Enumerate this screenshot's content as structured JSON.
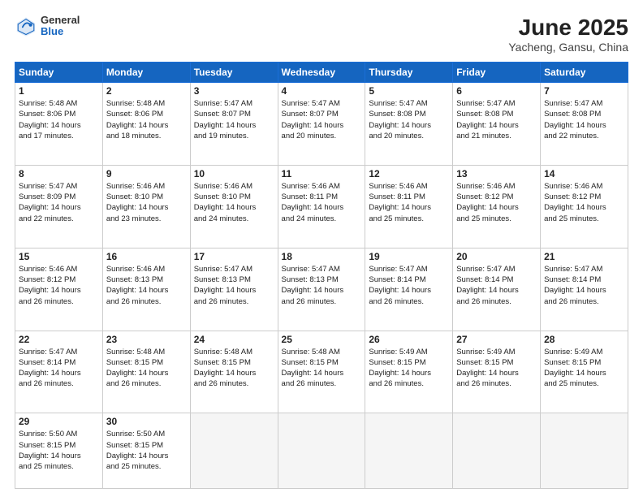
{
  "header": {
    "logo_general": "General",
    "logo_blue": "Blue",
    "month_title": "June 2025",
    "location": "Yacheng, Gansu, China"
  },
  "weekdays": [
    "Sunday",
    "Monday",
    "Tuesday",
    "Wednesday",
    "Thursday",
    "Friday",
    "Saturday"
  ],
  "weeks": [
    [
      {
        "day": 1,
        "info": "Sunrise: 5:48 AM\nSunset: 8:06 PM\nDaylight: 14 hours\nand 17 minutes."
      },
      {
        "day": 2,
        "info": "Sunrise: 5:48 AM\nSunset: 8:06 PM\nDaylight: 14 hours\nand 18 minutes."
      },
      {
        "day": 3,
        "info": "Sunrise: 5:47 AM\nSunset: 8:07 PM\nDaylight: 14 hours\nand 19 minutes."
      },
      {
        "day": 4,
        "info": "Sunrise: 5:47 AM\nSunset: 8:07 PM\nDaylight: 14 hours\nand 20 minutes."
      },
      {
        "day": 5,
        "info": "Sunrise: 5:47 AM\nSunset: 8:08 PM\nDaylight: 14 hours\nand 20 minutes."
      },
      {
        "day": 6,
        "info": "Sunrise: 5:47 AM\nSunset: 8:08 PM\nDaylight: 14 hours\nand 21 minutes."
      },
      {
        "day": 7,
        "info": "Sunrise: 5:47 AM\nSunset: 8:08 PM\nDaylight: 14 hours\nand 22 minutes."
      }
    ],
    [
      {
        "day": 8,
        "info": "Sunrise: 5:47 AM\nSunset: 8:09 PM\nDaylight: 14 hours\nand 22 minutes."
      },
      {
        "day": 9,
        "info": "Sunrise: 5:46 AM\nSunset: 8:10 PM\nDaylight: 14 hours\nand 23 minutes."
      },
      {
        "day": 10,
        "info": "Sunrise: 5:46 AM\nSunset: 8:10 PM\nDaylight: 14 hours\nand 24 minutes."
      },
      {
        "day": 11,
        "info": "Sunrise: 5:46 AM\nSunset: 8:11 PM\nDaylight: 14 hours\nand 24 minutes."
      },
      {
        "day": 12,
        "info": "Sunrise: 5:46 AM\nSunset: 8:11 PM\nDaylight: 14 hours\nand 25 minutes."
      },
      {
        "day": 13,
        "info": "Sunrise: 5:46 AM\nSunset: 8:12 PM\nDaylight: 14 hours\nand 25 minutes."
      },
      {
        "day": 14,
        "info": "Sunrise: 5:46 AM\nSunset: 8:12 PM\nDaylight: 14 hours\nand 25 minutes."
      }
    ],
    [
      {
        "day": 15,
        "info": "Sunrise: 5:46 AM\nSunset: 8:12 PM\nDaylight: 14 hours\nand 26 minutes."
      },
      {
        "day": 16,
        "info": "Sunrise: 5:46 AM\nSunset: 8:13 PM\nDaylight: 14 hours\nand 26 minutes."
      },
      {
        "day": 17,
        "info": "Sunrise: 5:47 AM\nSunset: 8:13 PM\nDaylight: 14 hours\nand 26 minutes."
      },
      {
        "day": 18,
        "info": "Sunrise: 5:47 AM\nSunset: 8:13 PM\nDaylight: 14 hours\nand 26 minutes."
      },
      {
        "day": 19,
        "info": "Sunrise: 5:47 AM\nSunset: 8:14 PM\nDaylight: 14 hours\nand 26 minutes."
      },
      {
        "day": 20,
        "info": "Sunrise: 5:47 AM\nSunset: 8:14 PM\nDaylight: 14 hours\nand 26 minutes."
      },
      {
        "day": 21,
        "info": "Sunrise: 5:47 AM\nSunset: 8:14 PM\nDaylight: 14 hours\nand 26 minutes."
      }
    ],
    [
      {
        "day": 22,
        "info": "Sunrise: 5:47 AM\nSunset: 8:14 PM\nDaylight: 14 hours\nand 26 minutes."
      },
      {
        "day": 23,
        "info": "Sunrise: 5:48 AM\nSunset: 8:15 PM\nDaylight: 14 hours\nand 26 minutes."
      },
      {
        "day": 24,
        "info": "Sunrise: 5:48 AM\nSunset: 8:15 PM\nDaylight: 14 hours\nand 26 minutes."
      },
      {
        "day": 25,
        "info": "Sunrise: 5:48 AM\nSunset: 8:15 PM\nDaylight: 14 hours\nand 26 minutes."
      },
      {
        "day": 26,
        "info": "Sunrise: 5:49 AM\nSunset: 8:15 PM\nDaylight: 14 hours\nand 26 minutes."
      },
      {
        "day": 27,
        "info": "Sunrise: 5:49 AM\nSunset: 8:15 PM\nDaylight: 14 hours\nand 26 minutes."
      },
      {
        "day": 28,
        "info": "Sunrise: 5:49 AM\nSunset: 8:15 PM\nDaylight: 14 hours\nand 25 minutes."
      }
    ],
    [
      {
        "day": 29,
        "info": "Sunrise: 5:50 AM\nSunset: 8:15 PM\nDaylight: 14 hours\nand 25 minutes."
      },
      {
        "day": 30,
        "info": "Sunrise: 5:50 AM\nSunset: 8:15 PM\nDaylight: 14 hours\nand 25 minutes."
      },
      null,
      null,
      null,
      null,
      null
    ]
  ]
}
